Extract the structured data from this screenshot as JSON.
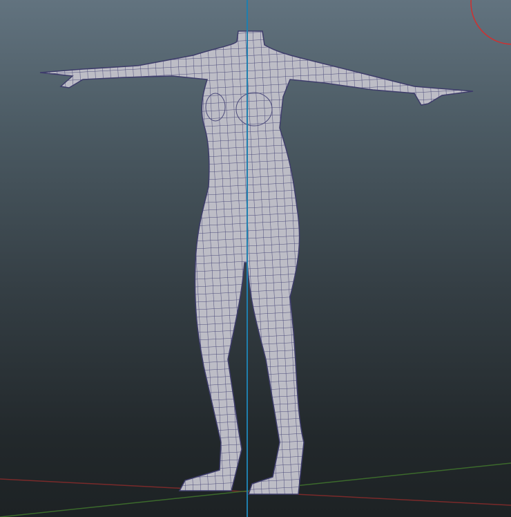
{
  "viewport": {
    "view": "perspective",
    "colors": {
      "mesh_fill": "#bdbdc6",
      "wireframe": "#4b4a7a",
      "y_axis": "#1f7fae",
      "x_axis": "#7a2a2a",
      "z_axis": "#3c6a2c",
      "manipulator": "#d03030"
    }
  }
}
